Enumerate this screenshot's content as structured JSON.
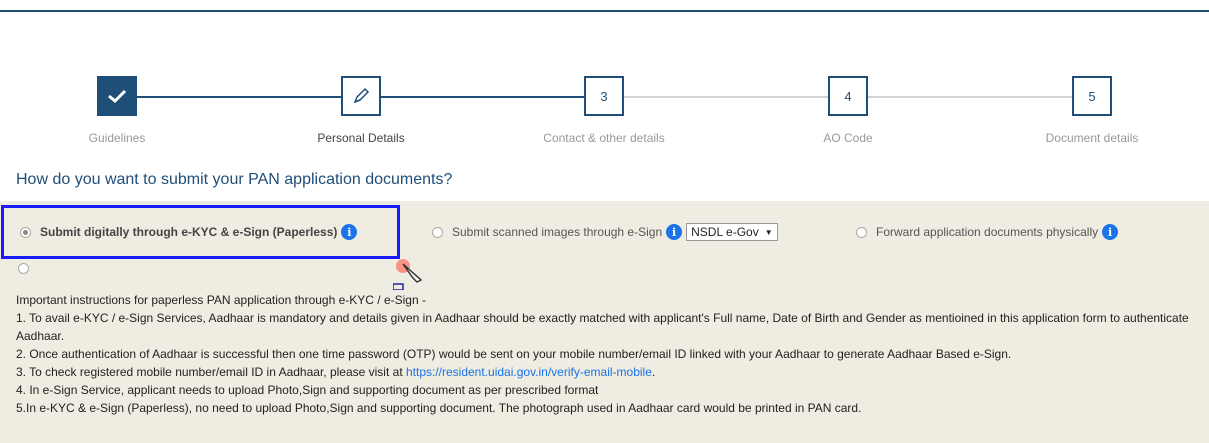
{
  "stepper": {
    "steps": [
      {
        "label": "Guidelines",
        "marker": "",
        "state": "done"
      },
      {
        "label": "Personal Details",
        "marker": "",
        "state": "active"
      },
      {
        "label": "Contact & other details",
        "marker": "3",
        "state": "pending"
      },
      {
        "label": "AO Code",
        "marker": "4",
        "state": "pending"
      },
      {
        "label": "Document details",
        "marker": "5",
        "state": "pending"
      }
    ]
  },
  "question": "How do you want to submit your PAN application documents?",
  "options": {
    "paperless": "Submit digitally through e-KYC & e-Sign (Paperless)",
    "scanned": "Submit scanned images through e-Sign",
    "scanned_select": "NSDL e-Gov",
    "physical": "Forward application documents physically",
    "info_glyph": "i"
  },
  "instructions": {
    "heading": "Important instructions for paperless PAN application through e-KYC / e-Sign -",
    "item1": "1. To avail e-KYC / e-Sign Services, Aadhaar is mandatory and details given in Aadhaar should be exactly matched with applicant's Full name, Date of Birth and Gender as mentioined in this application form to authenticate Aadhaar.",
    "item2": "2. Once authentication of Aadhaar is successful then one time password (OTP) would be sent on your mobile number/email ID linked with your Aadhaar to generate Aadhaar Based e-Sign.",
    "item3_prefix": "3. To check registered mobile number/email ID in Aadhaar, please visit at ",
    "item3_link": "https://resident.uidai.gov.in/verify-email-mobile",
    "item3_suffix": ".",
    "item4": "4. In e-Sign Service, applicant needs to upload Photo,Sign and supporting document as per prescribed format",
    "item5": "5.In e-KYC & e-Sign (Paperless), no need to upload Photo,Sign and supporting document. The photograph used in Aadhaar card would be printed in PAN card."
  },
  "colors": {
    "primary": "#1f4e79",
    "info": "#1a73e8",
    "highlight": "#1a1aff",
    "panel": "#efece1"
  }
}
